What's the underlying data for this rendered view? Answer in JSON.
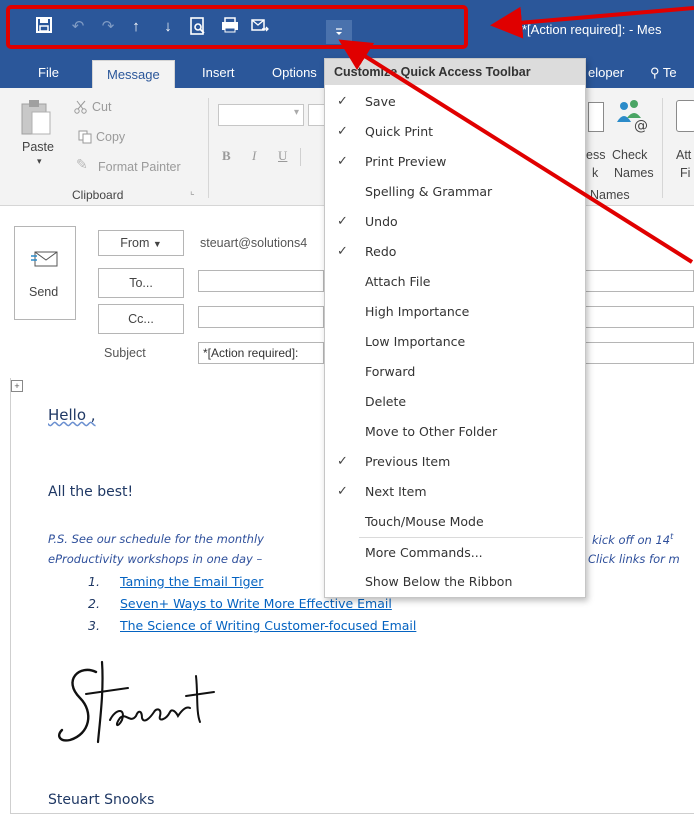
{
  "window": {
    "title": "*[Action required]: - Mes"
  },
  "qat": {
    "icons": [
      "save-icon",
      "undo-icon",
      "redo-icon",
      "previous-item-icon",
      "next-item-icon",
      "print-preview-icon",
      "quick-print-icon",
      "forward-icon",
      "customize-dropdown-icon"
    ]
  },
  "tabs": {
    "file": "File",
    "message": "Message",
    "insert": "Insert",
    "options": "Options",
    "developer": "eloper",
    "tell_me": "Te"
  },
  "ribbon": {
    "paste": "Paste",
    "cut": "Cut",
    "copy": "Copy",
    "format_painter": "Format Painter",
    "clipboard_group": "Clipboard",
    "address_book": "ess",
    "address_book_2": "k",
    "check_names": "Check",
    "check_names_2": "Names",
    "names_group": "Names",
    "attach": "Att",
    "attach_2": "Fi",
    "bold": "B",
    "italic": "I",
    "underline": "U"
  },
  "compose": {
    "send": "Send",
    "from": "From",
    "from_value": "steuart@solutions4",
    "to": "To...",
    "cc": "Cc...",
    "subject_label": "Subject",
    "subject_value": "*[Action required]:"
  },
  "body": {
    "greeting": "Hello ,",
    "closing": "All the best!",
    "ps_line1": "P.S. See our schedule for the monthly",
    "ps_line1_right": "kick off on 14",
    "ps_line1_sup": "t",
    "ps_line2": "eProductivity workshops in one day –",
    "ps_line2_right": "Click links for m",
    "list": [
      {
        "num": "1.",
        "text": "Taming the Email Tiger"
      },
      {
        "num": "2.",
        "text": "Seven+ Ways to Write More Effective Email"
      },
      {
        "num": "3.",
        "text": "The Science of Writing Customer-focused Email"
      }
    ],
    "signature_script": "Steuart",
    "signature_name": "Steuart Snooks"
  },
  "menu": {
    "title": "Customize Quick Access Toolbar",
    "items": [
      {
        "label": "Save",
        "checked": "✓"
      },
      {
        "label": "Quick Print",
        "checked": "✓"
      },
      {
        "label": "Print Preview",
        "checked": "✓"
      },
      {
        "label": "Spelling & Grammar",
        "checked": ""
      },
      {
        "label": "Undo",
        "checked": "✓"
      },
      {
        "label": "Redo",
        "checked": "✓"
      },
      {
        "label": "Attach File",
        "checked": ""
      },
      {
        "label": "High Importance",
        "checked": ""
      },
      {
        "label": "Low Importance",
        "checked": ""
      },
      {
        "label": "Forward",
        "checked": ""
      },
      {
        "label": "Delete",
        "checked": ""
      },
      {
        "label": "Move to Other Folder",
        "checked": ""
      },
      {
        "label": "Previous Item",
        "checked": "✓"
      },
      {
        "label": "Next Item",
        "checked": "✓"
      },
      {
        "label": "Touch/Mouse Mode",
        "checked": ""
      },
      {
        "label": "More Commands...",
        "checked": ""
      },
      {
        "label": "Show Below the Ribbon",
        "checked": ""
      }
    ]
  },
  "colors": {
    "title_blue": "#2b579a",
    "highlight_red": "#e00000",
    "link_blue": "#0563c1",
    "body_navy": "#1f3864"
  }
}
